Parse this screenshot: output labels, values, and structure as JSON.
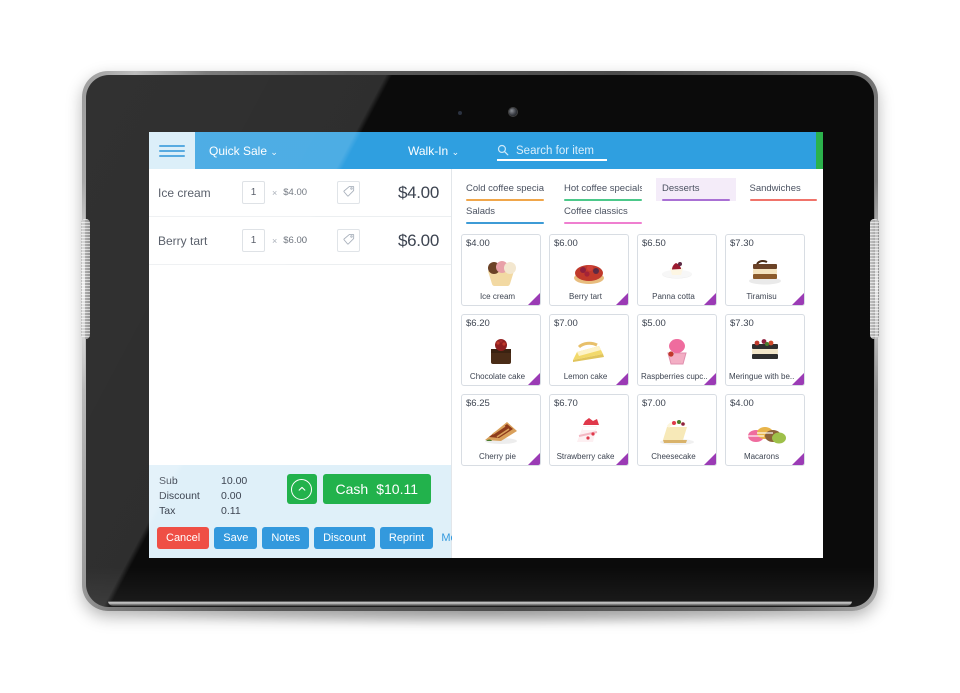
{
  "topbar": {
    "menu_icon": "hamburger-icon",
    "quick_sale_label": "Quick Sale",
    "customer_label": "Walk-In",
    "caret": "⌄",
    "search_icon": "search-icon",
    "search_placeholder": "Search for item",
    "search_value": "",
    "accent_blue": "#2f9fe0",
    "accent_green": "#2bb24c"
  },
  "cart": {
    "items": [
      {
        "name": "Ice cream",
        "qty": "1",
        "times": "×",
        "unit_price": "$4.00",
        "line_total": "$4.00",
        "tag_icon": "tag-icon"
      },
      {
        "name": "Berry tart",
        "qty": "1",
        "times": "×",
        "unit_price": "$6.00",
        "line_total": "$6.00",
        "tag_icon": "tag-icon"
      }
    ],
    "totals": [
      {
        "label": "Sub",
        "value": "10.00"
      },
      {
        "label": "Discount",
        "value": "0.00"
      },
      {
        "label": "Tax",
        "value": "0.11"
      }
    ],
    "collapse_icon": "chevron-up-icon",
    "pay_label": "Cash",
    "pay_amount": "$10.11",
    "actions": [
      {
        "label": "Cancel",
        "style": "red"
      },
      {
        "label": "Save",
        "style": "blue"
      },
      {
        "label": "Notes",
        "style": "blue"
      },
      {
        "label": "Discount",
        "style": "blue"
      },
      {
        "label": "Reprint",
        "style": "blue"
      }
    ],
    "more_label": "More"
  },
  "catalog": {
    "tabs": [
      {
        "label": "Cold coffee specials",
        "color": "#f0a64a",
        "active": false
      },
      {
        "label": "Hot coffee specials",
        "color": "#4cc88a",
        "active": false
      },
      {
        "label": "Desserts",
        "color": "#a濃",
        "active": true
      },
      {
        "label": "Sandwiches",
        "color": "#f0736a",
        "active": false
      },
      {
        "label": "Salads",
        "color": "#3d9bd6",
        "active": false
      },
      {
        "label": "Coffee classics",
        "color": "#ef7fd0",
        "active": false
      }
    ],
    "tab_colors": [
      "#f0a64a",
      "#4cc88a",
      "#a970d4",
      "#f0736a",
      "#3d9bd6",
      "#ef7fd0"
    ],
    "products": [
      {
        "price": "$4.00",
        "name": "Ice cream",
        "art": "ice-cream-icon"
      },
      {
        "price": "$6.00",
        "name": "Berry tart",
        "art": "berry-tart-icon"
      },
      {
        "price": "$6.50",
        "name": "Panna cotta",
        "art": "panna-cotta-icon"
      },
      {
        "price": "$7.30",
        "name": "Tiramisu",
        "art": "tiramisu-icon"
      },
      {
        "price": "$6.20",
        "name": "Chocolate cake",
        "art": "chocolate-cake-icon"
      },
      {
        "price": "$7.00",
        "name": "Lemon cake",
        "art": "lemon-cake-icon"
      },
      {
        "price": "$5.00",
        "name": "Raspberries cupc..",
        "art": "cupcake-icon"
      },
      {
        "price": "$7.30",
        "name": "Meringue with be..",
        "art": "meringue-icon"
      },
      {
        "price": "$6.25",
        "name": "Cherry pie",
        "art": "cherry-pie-icon"
      },
      {
        "price": "$6.70",
        "name": "Strawberry cake",
        "art": "strawberry-cake-icon"
      },
      {
        "price": "$7.00",
        "name": "Cheesecake",
        "art": "cheesecake-icon"
      },
      {
        "price": "$4.00",
        "name": "Macarons",
        "art": "macarons-icon"
      }
    ],
    "flag_color": "#9b3bb5"
  }
}
